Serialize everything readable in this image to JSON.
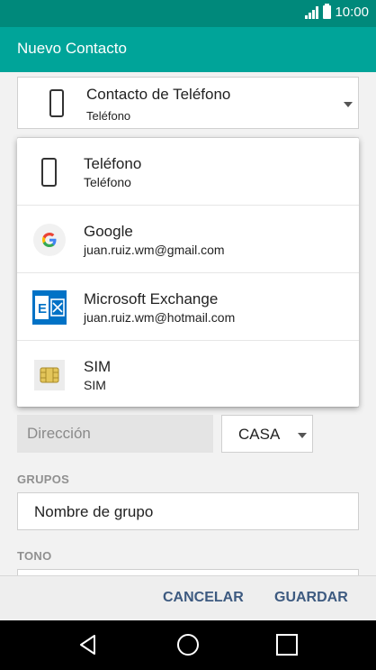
{
  "status_bar": {
    "time": "10:00",
    "icons": [
      "signal-icon",
      "battery-icon"
    ]
  },
  "app_bar": {
    "title": "Nuevo Contacto"
  },
  "account": {
    "selected_title": "Contacto de Teléfono",
    "selected_sub": "Teléfono"
  },
  "dropdown": {
    "items": [
      {
        "title": "Teléfono",
        "sub": "Teléfono",
        "icon": "phone-icon"
      },
      {
        "title": "Google",
        "sub": "juan.ruiz.wm@gmail.com",
        "icon": "google-icon"
      },
      {
        "title": "Microsoft Exchange",
        "sub": "juan.ruiz.wm@hotmail.com",
        "icon": "exchange-icon"
      },
      {
        "title": "SIM",
        "sub": "SIM",
        "icon": "sim-icon"
      }
    ]
  },
  "address": {
    "placeholder": "Dirección",
    "type_value": "CASA"
  },
  "groups": {
    "label": "GRUPOS",
    "value": "Nombre de grupo"
  },
  "tone": {
    "label": "TONO"
  },
  "footer": {
    "cancel": "CANCELAR",
    "save": "GUARDAR"
  },
  "nav": {
    "icons": [
      "back-icon",
      "home-icon",
      "recents-icon"
    ]
  },
  "colors": {
    "status_bar": "#00897b",
    "app_bar": "#00a499",
    "action_text": "#3d5a80"
  }
}
